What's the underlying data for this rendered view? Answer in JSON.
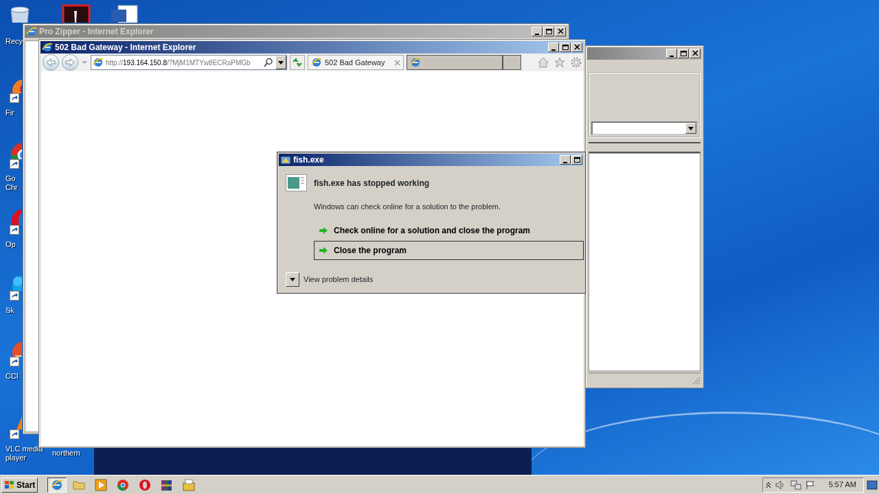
{
  "desktop_icons": [
    {
      "kind": "recycle",
      "shortcut": false,
      "label_lines": [
        "Recy"
      ]
    },
    {
      "kind": "pdf",
      "shortcut": false
    },
    {
      "kind": "word",
      "shortcut": false
    },
    {
      "kind": "firefox",
      "shortcut": true,
      "label_lines": [
        "Fir"
      ]
    },
    {
      "kind": "chrome",
      "shortcut": true,
      "label_lines": [
        "Go",
        "Chr"
      ]
    },
    {
      "kind": "opera",
      "shortcut": true,
      "label_lines": [
        "Op"
      ]
    },
    {
      "kind": "skype",
      "shortcut": true,
      "label_lines": [
        "Sk"
      ]
    },
    {
      "kind": "ccleaner",
      "shortcut": true,
      "label_lines": [
        "CCl"
      ]
    },
    {
      "kind": "vlc",
      "shortcut": true,
      "label_lines": [
        "VLC media",
        "player"
      ]
    },
    {
      "kind": "hidden",
      "shortcut": false,
      "label_lines": [
        "northern"
      ]
    }
  ],
  "back_window": {
    "active": false
  },
  "pro_zipper_window": {
    "title": "Pro Zipper - Internet Explorer",
    "active": false
  },
  "browser_window": {
    "title": "502 Bad Gateway - Internet Explorer",
    "active": true,
    "address": {
      "scheme": "http://",
      "host": "193.164.150.8",
      "path": "/?MjM1MTYw8ECRaPMGb"
    },
    "tabs": [
      {
        "label": "502 Bad Gateway",
        "selected": true
      },
      {
        "selected": false
      }
    ]
  },
  "dialog": {
    "title": "fish.exe",
    "heading": "fish.exe has stopped working",
    "message": "Windows can check online for a solution to the problem.",
    "options": [
      {
        "label": "Check online for a solution and close the program",
        "selected": false
      },
      {
        "label": "Close the program",
        "selected": true
      }
    ],
    "details_toggle": {
      "label": "View problem details",
      "expanded": false
    }
  },
  "taskbar": {
    "start_label": "Start",
    "apps": [
      {
        "kind": "ie",
        "selected": true
      },
      {
        "kind": "folder",
        "selected": false
      },
      {
        "kind": "media",
        "selected": false
      },
      {
        "kind": "chrome",
        "selected": false
      },
      {
        "kind": "opera",
        "selected": false
      },
      {
        "kind": "winrar",
        "selected": false
      },
      {
        "kind": "installer",
        "selected": false
      }
    ],
    "clock": "5:57 AM"
  }
}
